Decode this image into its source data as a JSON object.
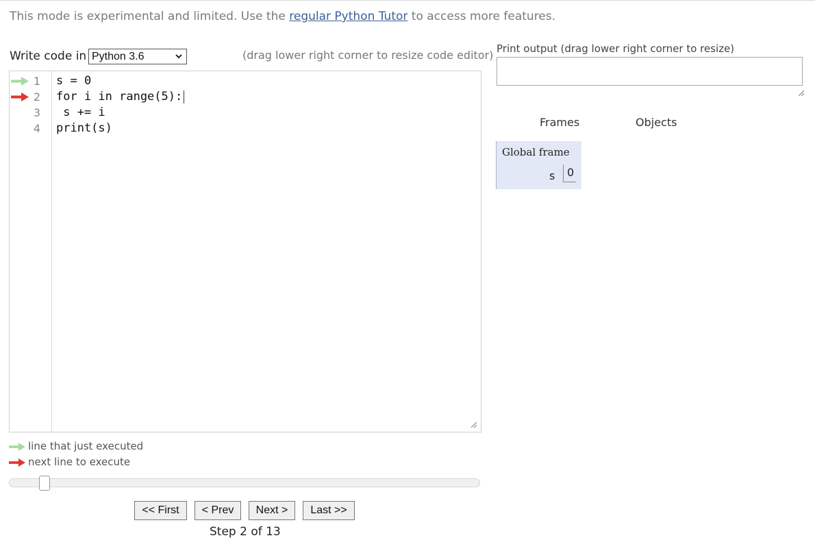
{
  "banner": {
    "prefix": "This mode is experimental and limited. Use the",
    "link": "regular Python Tutor",
    "suffix": "to access more features."
  },
  "editor_header": {
    "write_label": "Write code in",
    "language": "Python 3.6",
    "resize_hint": "(drag lower right corner to resize code editor)"
  },
  "code": {
    "lines": [
      {
        "num": "1",
        "arrow": "green"
      },
      {
        "num": "2",
        "arrow": "red"
      },
      {
        "num": "3",
        "arrow": ""
      },
      {
        "num": "4",
        "arrow": ""
      }
    ],
    "line_text": [
      "s = 0",
      "for i in range(5):",
      " s += i",
      "print(s)"
    ]
  },
  "legend": {
    "just_executed": "line that just executed",
    "next_to_execute": "next line to execute",
    "colors": {
      "green": "#a6dba0",
      "red": "#e0372d"
    }
  },
  "navigation": {
    "first": "<< First",
    "prev": "< Prev",
    "next": "Next >",
    "last": "Last >>",
    "step_text": "Step 2 of 13",
    "current_step": 2,
    "total_steps": 13
  },
  "output_panel": {
    "label": "Print output (drag lower right corner to resize)",
    "content": ""
  },
  "viz": {
    "frames_header": "Frames",
    "objects_header": "Objects",
    "global_frame": {
      "title": "Global frame",
      "vars": [
        {
          "name": "s",
          "value": "0"
        }
      ]
    }
  }
}
